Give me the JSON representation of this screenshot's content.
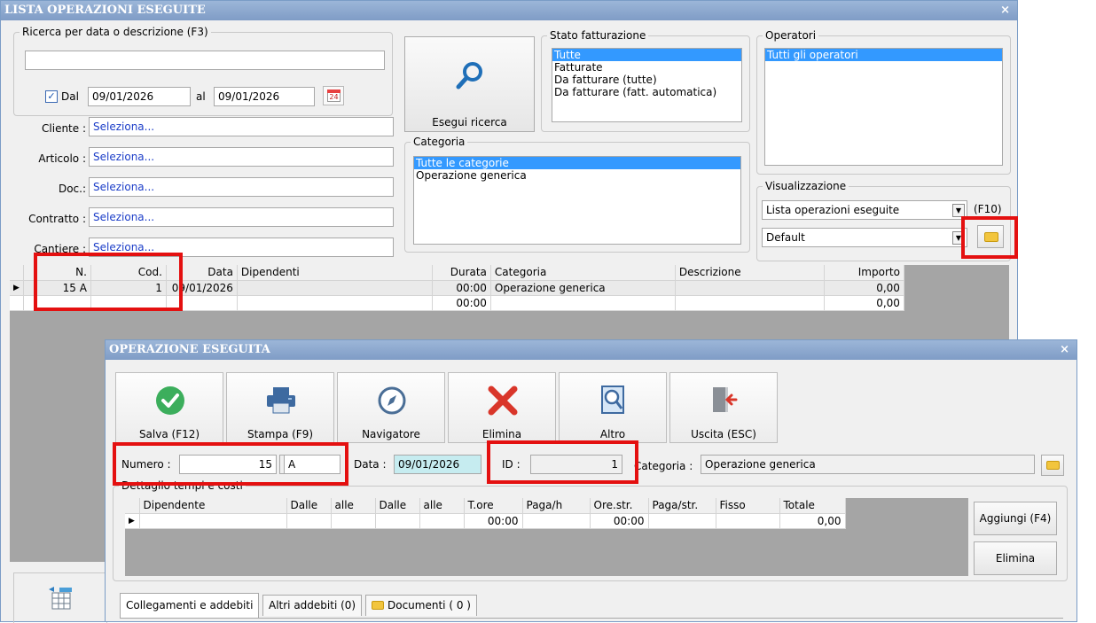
{
  "main_window": {
    "title": "LISTA OPERAZIONI ESEGUITE",
    "close": "×",
    "search": {
      "legend": "Ricerca per data o descrizione (F3)",
      "text_value": "",
      "dal_label": "Dal",
      "dal_checked": true,
      "date_from": "09/01/2026",
      "al_label": "al",
      "date_to": "09/01/2026",
      "calendar_day": "24",
      "cliente_label": "Cliente :",
      "cliente_value": "Seleziona...",
      "articolo_label": "Articolo :",
      "articolo_value": "Seleziona...",
      "doc_label": "Doc.:",
      "doc_value": "Seleziona...",
      "contratto_label": "Contratto :",
      "contratto_value": "Seleziona...",
      "cantiere_label": "Cantiere :",
      "cantiere_value": "Seleziona..."
    },
    "search_button": "Esegui ricerca",
    "stato": {
      "legend": "Stato fatturazione",
      "items": [
        "Tutte",
        "Fatturate",
        "Da fatturare (tutte)",
        "Da fatturare (fatt. automatica)"
      ],
      "selected_index": 0
    },
    "categoria": {
      "legend": "Categoria",
      "items": [
        "Tutte le categorie",
        "Operazione generica"
      ],
      "selected_index": 0
    },
    "operatori": {
      "legend": "Operatori",
      "items": [
        "Tutti gli operatori"
      ],
      "selected_index": 0
    },
    "visualizzazione": {
      "legend": "Visualizzazione",
      "view_value": "Lista operazioni eseguite",
      "shortcut": "(F10)",
      "layout_value": "Default"
    },
    "grid": {
      "columns": [
        "N.",
        "Cod.",
        "Data",
        "Dipendenti",
        "Durata",
        "Categoria",
        "Descrizione",
        "Importo"
      ],
      "rows": [
        {
          "n": "15 A",
          "cod": "1",
          "data": "09/01/2026",
          "dipendenti": "",
          "durata": "00:00",
          "categoria": "Operazione generica",
          "descrizione": "",
          "importo": "0,00"
        },
        {
          "n": "",
          "cod": "",
          "data": "",
          "dipendenti": "",
          "durata": "00:00",
          "categoria": "",
          "descrizione": "",
          "importo": "0,00"
        }
      ]
    }
  },
  "dialog": {
    "title": "OPERAZIONE ESEGUITA",
    "close": "×",
    "toolbar": {
      "save": "Salva (F12)",
      "print": "Stampa (F9)",
      "navigator": "Navigatore",
      "delete": "Elimina",
      "more": "Altro",
      "exit": "Uscita (ESC)"
    },
    "numero_label": "Numero :",
    "numero_value": "15",
    "suffix_value": "A",
    "data_label": "Data :",
    "data_value": "09/01/2026",
    "id_label": "ID :",
    "id_value": "1",
    "categoria_label": "Categoria :",
    "categoria_value": "Operazione generica",
    "dettaglio_legend": "Dettaglio tempi e costi",
    "detail_grid": {
      "columns": [
        "Dipendente",
        "Dalle",
        "alle",
        "Dalle",
        "alle",
        "T.ore",
        "Paga/h",
        "Ore.str.",
        "Paga/str.",
        "Fisso",
        "Totale"
      ],
      "row": {
        "t_ore": "00:00",
        "ore_str": "00:00",
        "totale": "0,00"
      }
    },
    "add_button": "Aggiungi (F4)",
    "delete_row_button": "Elimina",
    "tabs": [
      "Collegamenti e addebiti",
      "Altri addebiti (0)",
      "Documenti ( 0 )"
    ]
  },
  "colors": {
    "highlight_box": "#e41010",
    "selection": "#3399ff",
    "title_bar": "#8aa8d0"
  }
}
